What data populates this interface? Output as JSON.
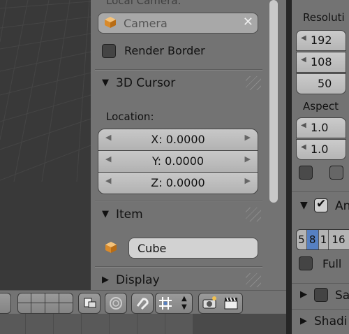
{
  "npanel": {
    "local_camera_label": "Local Camera:",
    "camera_field": {
      "value": "Camera",
      "clear_glyph": "✕",
      "icon": "cube-icon"
    },
    "render_border_label": "Render Border",
    "cursor_section": {
      "triangle": "▼",
      "title": "3D Cursor"
    },
    "location_label": "Location:",
    "location": [
      {
        "label": "X:",
        "value": "0.0000"
      },
      {
        "label": "Y:",
        "value": "0.0000"
      },
      {
        "label": "Z:",
        "value": "0.0000"
      }
    ],
    "item_section": {
      "triangle": "▼",
      "title": "Item"
    },
    "item_name": "Cube",
    "display_section": {
      "triangle": "▶",
      "title": "Display"
    }
  },
  "props": {
    "resolution_label": "Resoluti",
    "res_x": "192",
    "res_y": "108",
    "res_pct": "50",
    "aspect_label": "Aspect",
    "aspect_x": "1.0",
    "aspect_y": "1.0",
    "anim_triangle": "▼",
    "anim_label": "An",
    "sample_buttons": [
      "5",
      "8",
      "1",
      "16"
    ],
    "full_label": "Full",
    "sampled_triangle": "▶",
    "sampled_label": "Sa",
    "shading_triangle": "▶",
    "shading_label": "Shadi"
  },
  "colors": {
    "accent": "#5680c2",
    "panel": "#737373"
  }
}
